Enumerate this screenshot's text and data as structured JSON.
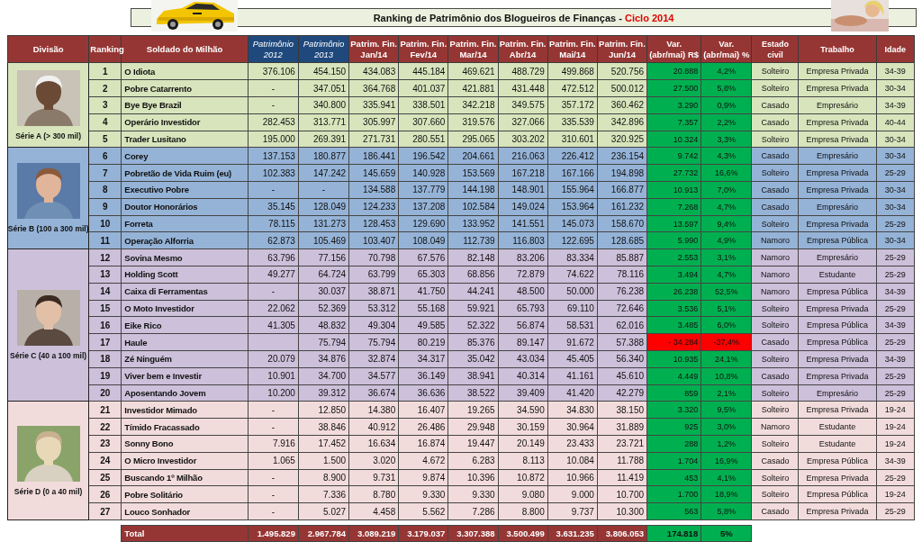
{
  "title": {
    "text": "Ranking de Patrimônio dos Blogueiros de Finanças - ",
    "highlight": "Ciclo 2014"
  },
  "columns": [
    {
      "label": "Divisão",
      "kind": "plain"
    },
    {
      "label": "Ranking",
      "kind": "plain"
    },
    {
      "label": "Soldado do Milhão",
      "kind": "plain"
    },
    {
      "label": "Patrimônio 2012",
      "kind": "past"
    },
    {
      "label": "Patrimônio 2013",
      "kind": "past"
    },
    {
      "label": "Patrim. Fin. Jan/14",
      "kind": "plain"
    },
    {
      "label": "Patrim. Fin. Fev/14",
      "kind": "plain"
    },
    {
      "label": "Patrim. Fin. Mar/14",
      "kind": "plain"
    },
    {
      "label": "Patrim. Fin. Abr/14",
      "kind": "plain"
    },
    {
      "label": "Patrim. Fin. Mai/14",
      "kind": "plain"
    },
    {
      "label": "Patrim. Fin. Jun/14",
      "kind": "plain"
    },
    {
      "label": "Var. (abr/mai) R$",
      "kind": "plain"
    },
    {
      "label": "Var. (abr/mai) %",
      "kind": "plain"
    },
    {
      "label": "Estado civil",
      "kind": "small"
    },
    {
      "label": "Trabalho",
      "kind": "small"
    },
    {
      "label": "Idade",
      "kind": "small"
    }
  ],
  "series": [
    {
      "label": "Série A (> 300 mil)",
      "color": "#d8e4bc",
      "rows": [
        {
          "ranking": "1",
          "name": "O Idiota",
          "patrimonio_2012": "376.106",
          "patrimonio_2013": "454.150",
          "months": [
            "434.083",
            "445.184",
            "469.621",
            "488.729",
            "499.868",
            "520.756"
          ],
          "var_rs": "20.888",
          "var_pct": "4,2%",
          "loss": false,
          "estado_civil": "Solteiro",
          "trabalho": "Empresa Privada",
          "idade": "34-39"
        },
        {
          "ranking": "2",
          "name": "Pobre Catarrento",
          "patrimonio_2012": "-",
          "patrimonio_2013": "347.051",
          "months": [
            "364.768",
            "401.037",
            "421.881",
            "431.448",
            "472.512",
            "500.012"
          ],
          "var_rs": "27.500",
          "var_pct": "5,8%",
          "loss": false,
          "estado_civil": "Solteiro",
          "trabalho": "Empresa Privada",
          "idade": "30-34"
        },
        {
          "ranking": "3",
          "name": "Bye Bye Brazil",
          "patrimonio_2012": "-",
          "patrimonio_2013": "340.800",
          "months": [
            "335.941",
            "338.501",
            "342.218",
            "349.575",
            "357.172",
            "360.462"
          ],
          "var_rs": "3.290",
          "var_pct": "0,9%",
          "loss": false,
          "estado_civil": "Casado",
          "trabalho": "Empresário",
          "idade": "34-39"
        },
        {
          "ranking": "4",
          "name": "Operário Investidor",
          "patrimonio_2012": "282.453",
          "patrimonio_2013": "313.771",
          "months": [
            "305.997",
            "307.660",
            "319.576",
            "327.066",
            "335.539",
            "342.896"
          ],
          "var_rs": "7.357",
          "var_pct": "2,2%",
          "loss": false,
          "estado_civil": "Casado",
          "trabalho": "Empresa Privada",
          "idade": "40-44"
        },
        {
          "ranking": "5",
          "name": "Trader Lusitano",
          "patrimonio_2012": "195.000",
          "patrimonio_2013": "269.391",
          "months": [
            "271.731",
            "280.551",
            "295.065",
            "303.202",
            "310.601",
            "320.925"
          ],
          "var_rs": "10.324",
          "var_pct": "3,3%",
          "loss": false,
          "estado_civil": "Solteiro",
          "trabalho": "Empresa Privada",
          "idade": "30-34"
        }
      ]
    },
    {
      "label": "Série B (100 a 300 mil)",
      "color": "#95b3d7",
      "rows": [
        {
          "ranking": "6",
          "name": "Corey",
          "patrimonio_2012": "137.153",
          "patrimonio_2013": "180.877",
          "months": [
            "186.441",
            "196.542",
            "204.661",
            "216.063",
            "226.412",
            "236.154"
          ],
          "var_rs": "9.742",
          "var_pct": "4,3%",
          "loss": false,
          "estado_civil": "Casado",
          "trabalho": "Empresário",
          "idade": "30-34"
        },
        {
          "ranking": "7",
          "name": "Pobretão de Vida Ruim (eu)",
          "patrimonio_2012": "102.383",
          "patrimonio_2013": "147.242",
          "months": [
            "145.659",
            "140.928",
            "153.569",
            "167.218",
            "167.166",
            "194.898"
          ],
          "var_rs": "27.732",
          "var_pct": "16,6%",
          "loss": false,
          "estado_civil": "Solteiro",
          "trabalho": "Empresa Privada",
          "idade": "25-29"
        },
        {
          "ranking": "8",
          "name": "Executivo Pobre",
          "patrimonio_2012": "-",
          "patrimonio_2013": "-",
          "months": [
            "134.588",
            "137.779",
            "144.198",
            "148.901",
            "155.964",
            "166.877"
          ],
          "var_rs": "10.913",
          "var_pct": "7,0%",
          "loss": false,
          "estado_civil": "Casado",
          "trabalho": "Empresa Privada",
          "idade": "30-34"
        },
        {
          "ranking": "9",
          "name": "Doutor Honorários",
          "patrimonio_2012": "35.145",
          "patrimonio_2013": "128.049",
          "months": [
            "124.233",
            "137.208",
            "102.584",
            "149.024",
            "153.964",
            "161.232"
          ],
          "var_rs": "7.268",
          "var_pct": "4,7%",
          "loss": false,
          "estado_civil": "Casado",
          "trabalho": "Empresário",
          "idade": "30-34"
        },
        {
          "ranking": "10",
          "name": "Forreta",
          "patrimonio_2012": "78.115",
          "patrimonio_2013": "131.273",
          "months": [
            "128.453",
            "129.690",
            "133.952",
            "141.551",
            "145.073",
            "158.670"
          ],
          "var_rs": "13.597",
          "var_pct": "9,4%",
          "loss": false,
          "estado_civil": "Solteiro",
          "trabalho": "Empresa Privada",
          "idade": "25-29"
        },
        {
          "ranking": "11",
          "name": "Operação Alforria",
          "patrimonio_2012": "62.873",
          "patrimonio_2013": "105.469",
          "months": [
            "103.407",
            "108.049",
            "112.739",
            "116.803",
            "122.695",
            "128.685"
          ],
          "var_rs": "5.990",
          "var_pct": "4,9%",
          "loss": false,
          "estado_civil": "Namoro",
          "trabalho": "Empresa Pública",
          "idade": "30-34"
        }
      ]
    },
    {
      "label": "Série C (40 a 100 mil)",
      "color": "#ccc0da",
      "rows": [
        {
          "ranking": "12",
          "name": "Sovina Mesmo",
          "patrimonio_2012": "63.796",
          "patrimonio_2013": "77.156",
          "months": [
            "70.798",
            "67.576",
            "82.148",
            "83.206",
            "83.334",
            "85.887"
          ],
          "var_rs": "2.553",
          "var_pct": "3,1%",
          "loss": false,
          "estado_civil": "Namoro",
          "trabalho": "Empresário",
          "idade": "25-29"
        },
        {
          "ranking": "13",
          "name": "Holding Scott",
          "patrimonio_2012": "49.277",
          "patrimonio_2013": "64.724",
          "months": [
            "63.799",
            "65.303",
            "68.856",
            "72.879",
            "74.622",
            "78.116"
          ],
          "var_rs": "3.494",
          "var_pct": "4,7%",
          "loss": false,
          "estado_civil": "Namoro",
          "trabalho": "Estudante",
          "idade": "25-29"
        },
        {
          "ranking": "14",
          "name": "Caixa di Ferramentas",
          "patrimonio_2012": "-",
          "patrimonio_2013": "30.037",
          "months": [
            "38.871",
            "41.750",
            "44.241",
            "48.500",
            "50.000",
            "76.238"
          ],
          "var_rs": "26.238",
          "var_pct": "52,5%",
          "loss": false,
          "estado_civil": "Namoro",
          "trabalho": "Empresa Pública",
          "idade": "34-39"
        },
        {
          "ranking": "15",
          "name": "O Moto Investidor",
          "patrimonio_2012": "22.062",
          "patrimonio_2013": "52.369",
          "months": [
            "53.312",
            "55.168",
            "59.921",
            "65.793",
            "69.110",
            "72.646"
          ],
          "var_rs": "3.536",
          "var_pct": "5,1%",
          "loss": false,
          "estado_civil": "Solteiro",
          "trabalho": "Empresa Privada",
          "idade": "25-29"
        },
        {
          "ranking": "16",
          "name": "Eike Rico",
          "patrimonio_2012": "41.305",
          "patrimonio_2013": "48.832",
          "months": [
            "49.304",
            "49.585",
            "52.322",
            "56.874",
            "58.531",
            "62.016"
          ],
          "var_rs": "3.485",
          "var_pct": "6,0%",
          "loss": false,
          "estado_civil": "Solteiro",
          "trabalho": "Empresa Pública",
          "idade": "34-39"
        },
        {
          "ranking": "17",
          "name": "Haule",
          "patrimonio_2013": "75.794",
          "months": [
            "75.794",
            "80.219",
            "85.376",
            "89.147",
            "91.672",
            "57.388"
          ],
          "var_rs": "- 34.284",
          "var_pct": "-37,4%",
          "loss": true,
          "estado_civil": "Casado",
          "trabalho": "Empresa Pública",
          "idade": "25-29"
        },
        {
          "ranking": "18",
          "name": "Zé Ninguém",
          "patrimonio_2012": "20.079",
          "patrimonio_2013": "34.876",
          "months": [
            "32.874",
            "34.317",
            "35.042",
            "43.034",
            "45.405",
            "56.340"
          ],
          "var_rs": "10.935",
          "var_pct": "24,1%",
          "loss": false,
          "estado_civil": "Solteiro",
          "trabalho": "Empresa Privada",
          "idade": "34-39"
        },
        {
          "ranking": "19",
          "name": "Viver bem e Investir",
          "patrimonio_2012": "10.901",
          "patrimonio_2013": "34.700",
          "months": [
            "34.577",
            "36.149",
            "38.941",
            "40.314",
            "41.161",
            "45.610"
          ],
          "var_rs": "4.449",
          "var_pct": "10,8%",
          "loss": false,
          "estado_civil": "Casado",
          "trabalho": "Empresa Privada",
          "idade": "25-29"
        },
        {
          "ranking": "20",
          "name": "Aposentando Jovem",
          "patrimonio_2012": "10.200",
          "patrimonio_2013": "39.312",
          "months": [
            "36.674",
            "36.636",
            "38.522",
            "39.409",
            "41.420",
            "42.279"
          ],
          "var_rs": "859",
          "var_pct": "2,1%",
          "loss": false,
          "estado_civil": "Solteiro",
          "trabalho": "Empresário",
          "idade": "25-29"
        }
      ]
    },
    {
      "label": "Série D (0 a 40 mil)",
      "color": "#f2dcdb",
      "rows": [
        {
          "ranking": "21",
          "name": "Investidor Mimado",
          "patrimonio_2012": "-",
          "patrimonio_2013": "12.850",
          "months": [
            "14.380",
            "16.407",
            "19.265",
            "34.590",
            "34.830",
            "38.150"
          ],
          "var_rs": "3.320",
          "var_pct": "9,5%",
          "loss": false,
          "estado_civil": "Solteiro",
          "trabalho": "Empresa Privada",
          "idade": "19-24"
        },
        {
          "ranking": "22",
          "name": "Tímido Fracassado",
          "patrimonio_2012": "-",
          "patrimonio_2013": "38.846",
          "months": [
            "40.912",
            "26.486",
            "29.948",
            "30.159",
            "30.964",
            "31.889"
          ],
          "var_rs": "925",
          "var_pct": "3,0%",
          "loss": false,
          "estado_civil": "Namoro",
          "trabalho": "Estudante",
          "idade": "19-24"
        },
        {
          "ranking": "23",
          "name": "Sonny Bono",
          "patrimonio_2012": "7.916",
          "patrimonio_2013": "17.452",
          "months": [
            "16.634",
            "16.874",
            "19.447",
            "20.149",
            "23.433",
            "23.721"
          ],
          "var_rs": "288",
          "var_pct": "1,2%",
          "loss": false,
          "estado_civil": "Solteiro",
          "trabalho": "Estudante",
          "idade": "19-24"
        },
        {
          "ranking": "24",
          "name": "O Micro Investidor",
          "patrimonio_2012": "1.065",
          "patrimonio_2013": "1.500",
          "months": [
            "3.020",
            "4.672",
            "6.283",
            "8.113",
            "10.084",
            "11.788"
          ],
          "var_rs": "1.704",
          "var_pct": "16,9%",
          "loss": false,
          "estado_civil": "Casado",
          "trabalho": "Empresa Pública",
          "idade": "34-39"
        },
        {
          "ranking": "25",
          "name": "Buscando 1º Milhão",
          "patrimonio_2012": "-",
          "patrimonio_2013": "8.900",
          "months": [
            "9.731",
            "9.874",
            "10.396",
            "10.872",
            "10.966",
            "11.419"
          ],
          "var_rs": "453",
          "var_pct": "4,1%",
          "loss": false,
          "estado_civil": "Solteiro",
          "trabalho": "Empresa Privada",
          "idade": "25-29"
        },
        {
          "ranking": "26",
          "name": "Pobre Solitário",
          "patrimonio_2012": "-",
          "patrimonio_2013": "7.336",
          "months": [
            "8.780",
            "9.330",
            "9.330",
            "9.080",
            "9.000",
            "10.700"
          ],
          "var_rs": "1.700",
          "var_pct": "18,9%",
          "loss": false,
          "estado_civil": "Solteiro",
          "trabalho": "Empresa Pública",
          "idade": "19-24"
        },
        {
          "ranking": "27",
          "name": "Louco Sonhador",
          "patrimonio_2012": "-",
          "patrimonio_2013": "5.027",
          "months": [
            "4.458",
            "5.562",
            "7.286",
            "8.800",
            "9.737",
            "10.300"
          ],
          "var_rs": "563",
          "var_pct": "5,8%",
          "loss": false,
          "estado_civil": "Casado",
          "trabalho": "Empresa Privada",
          "idade": "25-29"
        }
      ]
    }
  ],
  "total": {
    "label": "Total",
    "values": [
      "1.495.829",
      "2.967.784",
      "3.089.219",
      "3.179.037",
      "3.307.388",
      "3.500.499",
      "3.631.235",
      "3.806.053"
    ],
    "var_rs": "174.818",
    "var_pct": "5%"
  }
}
